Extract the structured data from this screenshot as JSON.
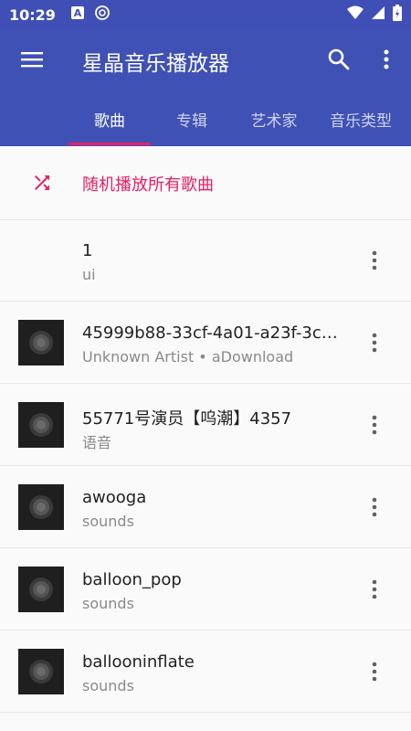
{
  "status": {
    "time": "10:29",
    "left_icons": [
      "a-icon",
      "pocket-icon"
    ],
    "right_icons": [
      "wifi-icon",
      "signal-icon",
      "battery-icon"
    ]
  },
  "app": {
    "title": "星晶音乐播放器"
  },
  "tabs": [
    {
      "label": "歌曲",
      "active": true
    },
    {
      "label": "专辑",
      "active": false
    },
    {
      "label": "艺术家",
      "active": false
    },
    {
      "label": "音乐类型",
      "active": false
    }
  ],
  "shuffle": {
    "label": "随机播放所有歌曲",
    "color": "#e91e63"
  },
  "songs": [
    {
      "title": "1",
      "subtitle": "ui",
      "has_thumb": false
    },
    {
      "title": "45999b88-33cf-4a01-a23f-3c6…",
      "subtitle": "Unknown Artist • aDownload",
      "has_thumb": true
    },
    {
      "title": "55771号演员【呜潮】4357",
      "subtitle": "语音",
      "has_thumb": true
    },
    {
      "title": "awooga",
      "subtitle": "sounds",
      "has_thumb": true
    },
    {
      "title": "balloon_pop",
      "subtitle": "sounds",
      "has_thumb": true
    },
    {
      "title": "ballooninflate",
      "subtitle": "sounds",
      "has_thumb": true
    }
  ],
  "colors": {
    "primary": "#3f51b5",
    "accent": "#e91e63"
  }
}
